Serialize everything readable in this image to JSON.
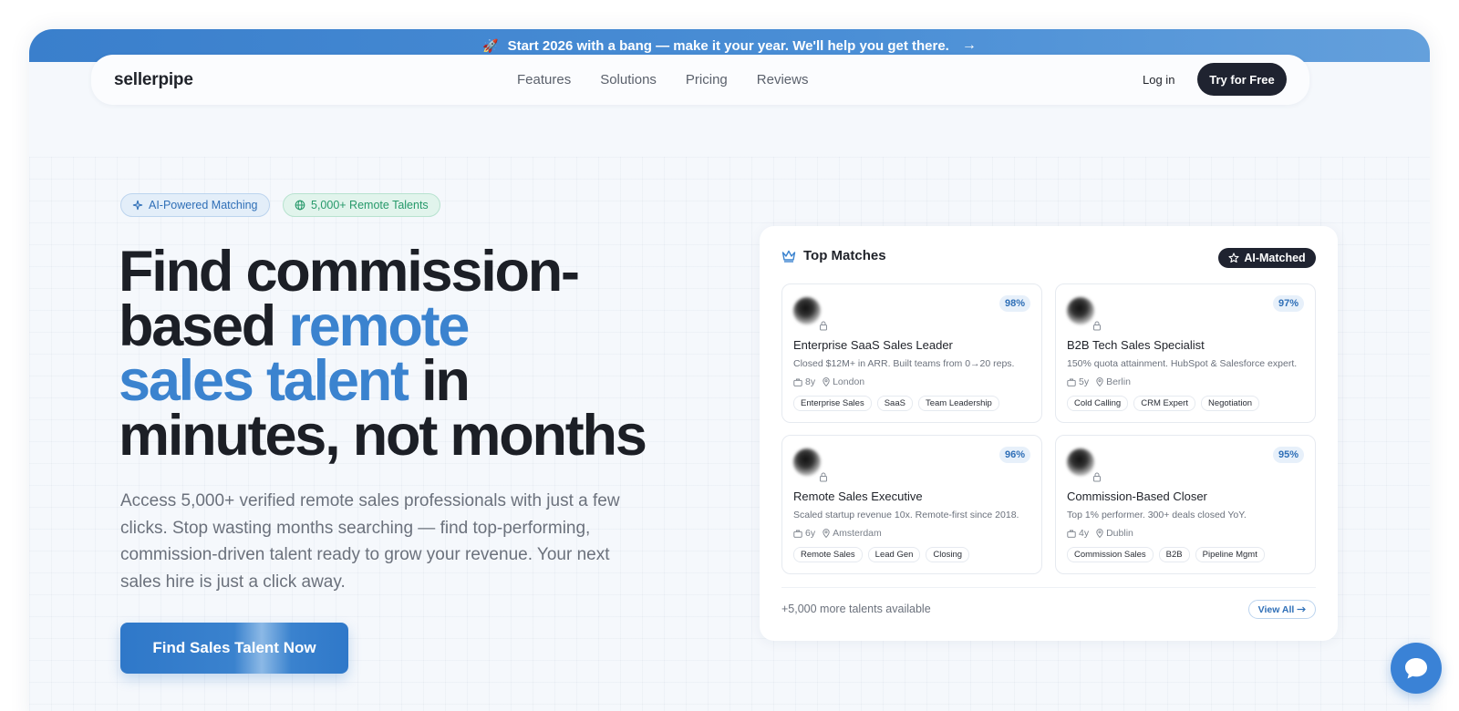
{
  "banner": {
    "icon": "rocket-icon",
    "text": "Start 2026 with a bang — make it your year. We'll help you get there.",
    "arrow": "→"
  },
  "nav": {
    "logo": "sellerpipe",
    "links": [
      "Features",
      "Solutions",
      "Pricing",
      "Reviews"
    ],
    "login": "Log in",
    "cta": "Try for Free"
  },
  "hero": {
    "pills": [
      "AI-Powered Matching",
      "5,000+ Remote Talents"
    ],
    "headline": {
      "line1": "Find commission-",
      "line2a": "based ",
      "line2b": "remote",
      "line3a": "sales talent",
      "line3b": " in",
      "line4": "minutes, not months"
    },
    "subtext": "Access 5,000+ verified remote sales professionals with just a few clicks. Stop wasting months searching — find top-performing, commission-driven talent ready to grow your revenue. Your next sales hire is just a click away.",
    "cta": "Find Sales Talent Now"
  },
  "panel": {
    "title": "Top Matches",
    "badge": "AI-Matched",
    "cards": [
      {
        "score": "98%",
        "title": "Enterprise SaaS Sales Leader",
        "desc": "Closed $12M+ in ARR. Built teams from 0→20 reps.",
        "years": "8y",
        "location": "London",
        "tags": [
          "Enterprise Sales",
          "SaaS",
          "Team Leadership"
        ]
      },
      {
        "score": "97%",
        "title": "B2B Tech Sales Specialist",
        "desc": "150% quota attainment. HubSpot & Salesforce expert.",
        "years": "5y",
        "location": "Berlin",
        "tags": [
          "Cold Calling",
          "CRM Expert",
          "Negotiation"
        ]
      },
      {
        "score": "96%",
        "title": "Remote Sales Executive",
        "desc": "Scaled startup revenue 10x. Remote-first since 2018.",
        "years": "6y",
        "location": "Amsterdam",
        "tags": [
          "Remote Sales",
          "Lead Gen",
          "Closing"
        ]
      },
      {
        "score": "95%",
        "title": "Commission-Based Closer",
        "desc": "Top 1% performer. 300+ deals closed YoY.",
        "years": "4y",
        "location": "Dublin",
        "tags": [
          "Commission Sales",
          "B2B",
          "Pipeline Mgmt"
        ]
      }
    ],
    "more": "+5,000 more talents available",
    "view_all": "View All"
  },
  "colors": {
    "accent": "#3b83cf",
    "dark": "#1f2330",
    "green": "#26996a"
  }
}
